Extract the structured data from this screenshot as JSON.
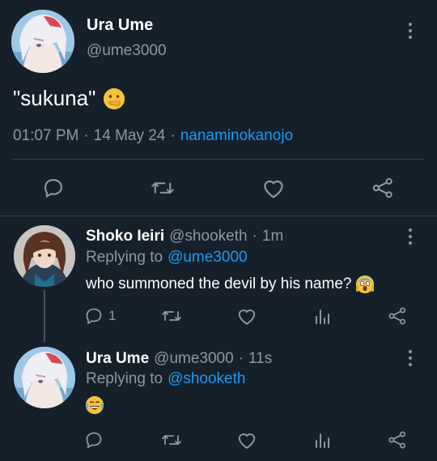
{
  "main_tweet": {
    "display_name": "Ura Ume",
    "handle": "@ume3000",
    "text": "\"sukuna\"",
    "emoji": "hand-over-mouth-emoji",
    "time": "01:07 PM",
    "sep1": "·",
    "date": "14 May 24",
    "sep2": "·",
    "via": "nanaminokanojo"
  },
  "actions": [
    "reply-icon",
    "retweet-icon",
    "like-icon",
    "share-icon"
  ],
  "reply1": {
    "display_name": "Shoko Ieiri",
    "handle": "@shooketh",
    "sep": "·",
    "age": "1m",
    "replying_prefix": "Replying to",
    "replying_to": "@ume3000",
    "text": "who summoned the devil by his name?",
    "emoji": "screaming-in-fear-emoji",
    "reply_count": "1"
  },
  "reply2": {
    "display_name": "Ura Ume",
    "handle": "@ume3000",
    "sep": "·",
    "age": "11s",
    "replying_prefix": "Replying to",
    "replying_to": "@shooketh",
    "emoji": "face-with-tears-of-joy-emoji"
  },
  "colors": {
    "background": "#15202b",
    "muted": "#8b98a5",
    "accent": "#1d9bf0",
    "divider": "#38444d"
  }
}
